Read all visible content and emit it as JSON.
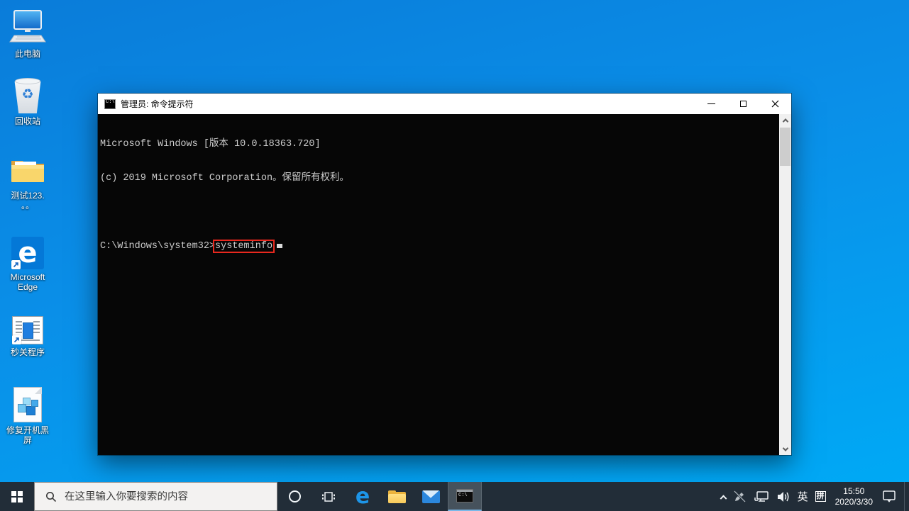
{
  "desktop": {
    "icons": [
      {
        "label": "此电脑",
        "label2": ""
      },
      {
        "label": "回收站",
        "label2": ""
      },
      {
        "label": "测试123.",
        "label2": "。。"
      },
      {
        "label": "Microsoft",
        "label2": "Edge"
      },
      {
        "label": "秒关程序",
        "label2": ""
      },
      {
        "label": "修复开机黑",
        "label2": "屏"
      }
    ]
  },
  "window": {
    "title": "管理员: 命令提示符",
    "console": {
      "line1": "Microsoft Windows [版本 10.0.18363.720]",
      "line2": "(c) 2019 Microsoft Corporation。保留所有权利。",
      "prompt": "C:\\Windows\\system32>",
      "command": "systeminfo"
    }
  },
  "taskbar": {
    "search_placeholder": "在这里输入你要搜索的内容",
    "tray": {
      "ime_lang": "英",
      "ime_mode": "拼",
      "time": "15:50",
      "date": "2020/3/30"
    }
  },
  "glyphs": {
    "edge_letter": "e",
    "recycle_symbol": "♻",
    "cmd_mini_text": "C:\\"
  },
  "colors": {
    "desktop_top": "#0a7cd9",
    "desktop_bottom": "#00a9f5",
    "taskbar_bg": "#222d38",
    "active_task_underline": "#7ab8e8",
    "console_bg": "#060606",
    "console_text": "#cccccc",
    "highlight_red": "#e8281e",
    "title_bar": "#ffffff"
  }
}
